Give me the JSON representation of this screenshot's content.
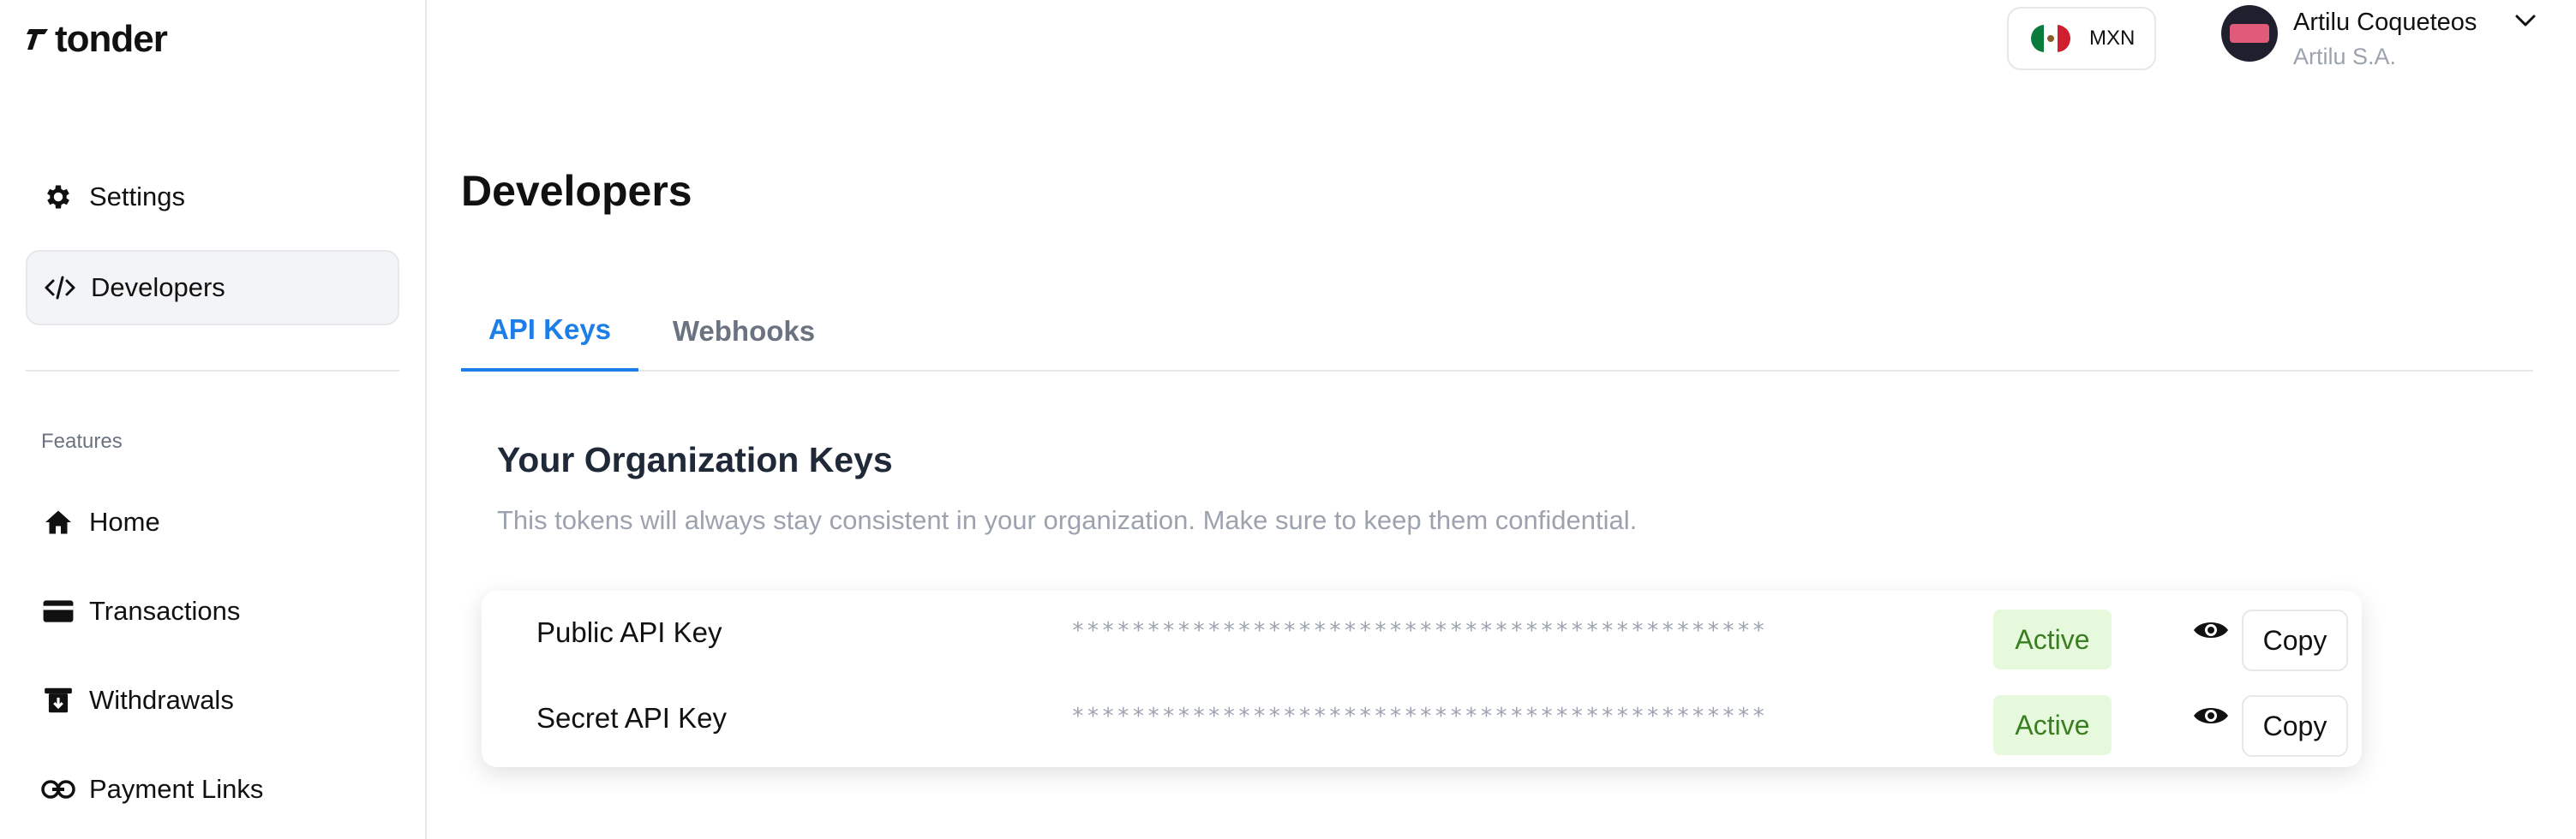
{
  "brand": {
    "name": "tonder",
    "logo_icon": "bolt-icon"
  },
  "sidebar": {
    "top_items": [
      {
        "label": "Settings",
        "icon": "gear-icon"
      },
      {
        "label": "Developers",
        "icon": "code-icon",
        "active": true
      }
    ],
    "features_label": "Features",
    "feature_items": [
      {
        "label": "Home",
        "icon": "home-icon"
      },
      {
        "label": "Transactions",
        "icon": "card-icon"
      },
      {
        "label": "Withdrawals",
        "icon": "withdrawal-icon"
      },
      {
        "label": "Payment Links",
        "icon": "link-icon"
      }
    ]
  },
  "header": {
    "currency": {
      "code": "MXN",
      "flag": "mexico-flag-icon"
    },
    "user": {
      "name": "Artilu Coqueteos",
      "organization": "Artilu S.A."
    }
  },
  "main": {
    "title": "Developers",
    "tabs": [
      {
        "label": "API Keys",
        "active": true
      },
      {
        "label": "Webhooks",
        "active": false
      }
    ],
    "section_title": "Your Organization Keys",
    "section_description": "This tokens will always stay consistent in your organization. Make sure to keep them confidential.",
    "keys": [
      {
        "name": "Public API Key",
        "masked_value": "**********************************************",
        "status": "Active",
        "copy_label": "Copy"
      },
      {
        "name": "Secret API Key",
        "masked_value": "**********************************************",
        "status": "Active",
        "copy_label": "Copy"
      }
    ]
  },
  "colors": {
    "accent": "#1d7ee8",
    "badge_bg": "#e7f9dc",
    "badge_text": "#3a7d22"
  }
}
